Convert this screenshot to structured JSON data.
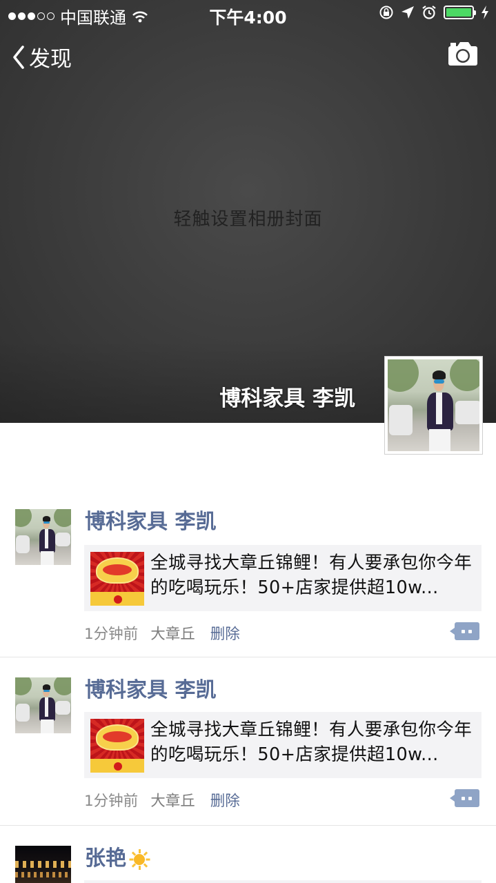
{
  "status_bar": {
    "carrier": "中国联通",
    "time": "下午4:00"
  },
  "nav": {
    "back_label": "发现"
  },
  "cover": {
    "hint": "轻触设置相册封面"
  },
  "profile": {
    "name": "博科家具 李凯"
  },
  "feed": [
    {
      "name": "博科家具 李凯",
      "link_text": "全城寻找大章丘锦鲤！有人要承包你今年的吃喝玩乐！50+店家提供超10w...",
      "time": "1分钟前",
      "location": "大章丘",
      "delete_label": "删除"
    },
    {
      "name": "博科家具 李凯",
      "link_text": "全城寻找大章丘锦鲤！有人要承包你今年的吃喝玩乐！50+店家提供超10w...",
      "time": "1分钟前",
      "location": "大章丘",
      "delete_label": "删除"
    },
    {
      "name": "张艳"
    }
  ],
  "colors": {
    "link_name": "#576b95",
    "card_bg": "#f3f3f5",
    "battery": "#4cd964"
  }
}
